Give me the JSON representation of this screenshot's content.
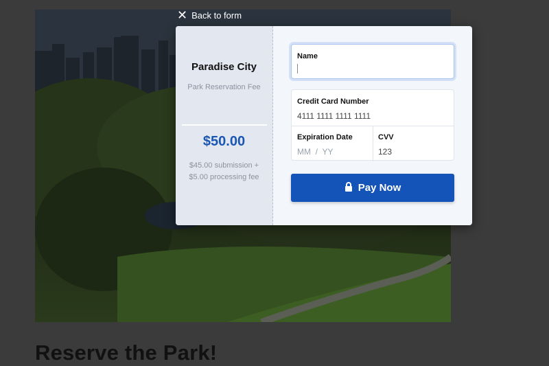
{
  "page": {
    "heading": "Reserve the Park!"
  },
  "modal": {
    "back_label": "Back to form",
    "merchant_name": "Paradise City",
    "description": "Park Reservation Fee",
    "amount": "$50.00",
    "breakdown_line1": "$45.00 submission +",
    "breakdown_line2": "$5.00 processing fee",
    "form": {
      "name_label": "Name",
      "name_value": "",
      "card_label": "Credit Card Number",
      "card_value": "4111 1111 1111 1111",
      "expiry_label": "Expiration Date",
      "expiry_placeholder": "MM  /  YY",
      "cvv_label": "CVV",
      "cvv_value": "123",
      "pay_label": "Pay Now"
    }
  },
  "icons": {
    "back": "close-icon",
    "pay": "lock-icon"
  },
  "colors": {
    "accent": "#1453b8",
    "amount": "#1a57b5",
    "summary_bg": "#e3e7ef",
    "form_bg": "#f3f6fb"
  }
}
